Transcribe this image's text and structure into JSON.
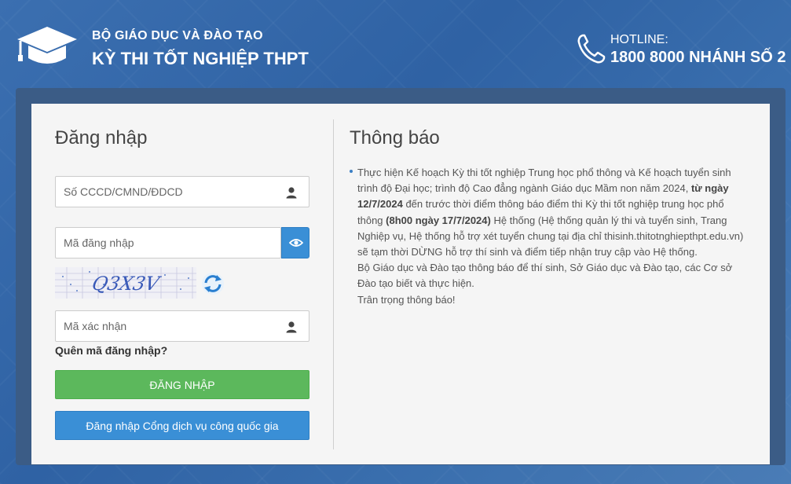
{
  "header": {
    "ministry": "BỘ GIÁO DỤC VÀ ĐÀO TẠO",
    "exam_title": "KỲ THI TỐT NGHIỆP THPT",
    "hotline_label": "HOTLINE:",
    "hotline_number": "1800 8000 NHÁNH SỐ 2",
    "logo_icon": "graduation-cap-icon",
    "phone_icon": "phone-icon"
  },
  "login": {
    "title": "Đăng nhập",
    "id_placeholder": "Số CCCD/CMND/ĐDCD",
    "password_placeholder": "Mã đăng nhập",
    "captcha_text": "Q3X3V",
    "captcha_placeholder": "Mã xác nhận",
    "forgot_label": "Quên mã đăng nhập?",
    "login_button": "ĐĂNG NHẬP",
    "gov_login_button": "Đăng nhập Cổng dịch vụ công quốc gia"
  },
  "notice": {
    "title": "Thông báo",
    "p1_a": "Thực hiện Kế hoạch Kỳ thi tốt nghiệp Trung học phổ thông và Kế hoạch tuyển sinh trình độ Đại học; trình độ Cao đẳng ngành Giáo dục Mầm non năm 2024, ",
    "p1_b": "từ ngày 12/7/2024",
    "p1_c": " đến trước thời điểm thông báo điểm thi Kỳ thi tốt nghiệp trung học phổ thông ",
    "p1_d": "(8h00 ngày 17/7/2024)",
    "p1_e": " Hệ thống (Hệ thống quản lý thi và tuyển sinh, Trang Nghiệp vụ, Hệ thống hỗ trợ xét tuyển chung tại địa chỉ thisinh.thitotnghiepthpt.edu.vn) sẽ tạm thời DỪNG hỗ trợ thí sinh và điểm tiếp nhận truy cập vào Hệ thống.",
    "p2": "Bộ Giáo dục và Đào tạo thông báo để thí sinh, Sở Giáo dục và Đào tạo, các Cơ sở Đào tạo biết và thực hiện.",
    "p3": "Trân trọng thông báo!"
  },
  "colors": {
    "background": "#3b6fb0",
    "frame": "#3b5c86",
    "login_green": "#5cb85c",
    "accent_blue": "#3a8fd6"
  }
}
